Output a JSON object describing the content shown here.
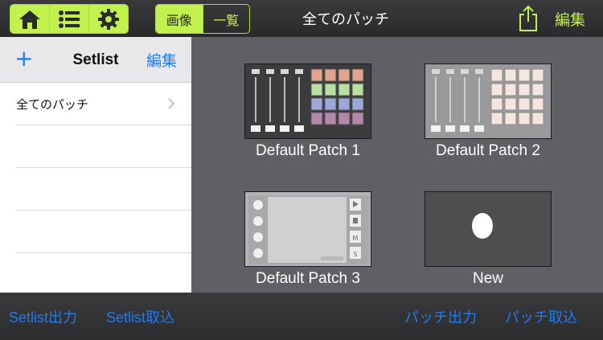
{
  "toolbar": {
    "mode_segments": [
      {
        "icon": "home-icon",
        "active": true
      },
      {
        "icon": "list-icon",
        "active": true
      },
      {
        "icon": "gear-icon",
        "active": true
      }
    ],
    "view_segments": [
      {
        "label": "画像",
        "active": true
      },
      {
        "label": "一覧",
        "active": false
      }
    ],
    "title": "全てのパッチ",
    "share_icon": "share-icon",
    "edit_label": "編集"
  },
  "sidebar": {
    "add_label": "+",
    "title": "Setlist",
    "edit_label": "編集",
    "items": [
      {
        "label": "全てのパッチ",
        "has_chevron": true
      },
      {
        "label": ""
      },
      {
        "label": ""
      },
      {
        "label": ""
      }
    ]
  },
  "patches": [
    {
      "name": "Default Patch 1"
    },
    {
      "name": "Default Patch 2"
    },
    {
      "name": "Default Patch 3"
    },
    {
      "name": "New"
    }
  ],
  "bottom": {
    "setlist_export": "Setlist出力",
    "setlist_import": "Setlist取込",
    "patch_export": "パッチ出力",
    "patch_import": "パッチ取込"
  },
  "colors": {
    "accent_green": "#c2f04c",
    "link_blue": "#1e7bf0",
    "content_bg": "#5f6064"
  }
}
